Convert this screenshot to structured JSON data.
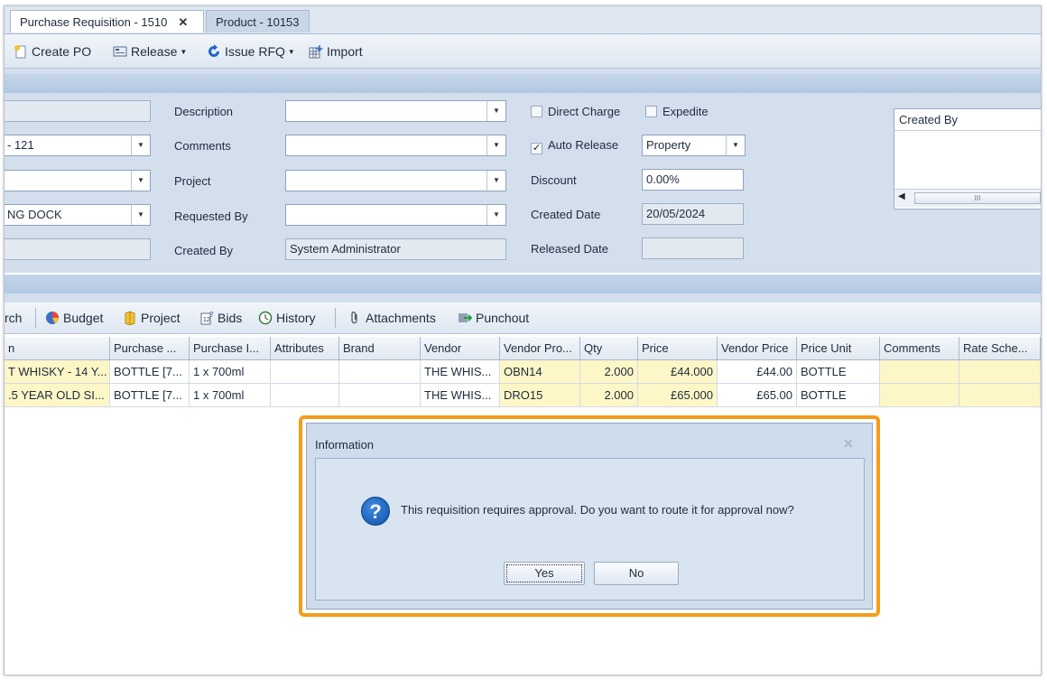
{
  "tabs": [
    {
      "label": "Purchase Requisition - 1510",
      "close": "✕"
    },
    {
      "label": "Product - 10153"
    }
  ],
  "toolbar": {
    "create_po": "Create PO",
    "release": "Release",
    "issue_rfq": "Issue RFQ",
    "import": "Import"
  },
  "form": {
    "left_col": {
      "field2_value": "- 121",
      "field3_value": "",
      "field4_value": "NG DOCK"
    },
    "mid_col": {
      "description_label": "Description",
      "comments_label": "Comments",
      "project_label": "Project",
      "requested_by_label": "Requested By",
      "created_by_label": "Created By",
      "created_by_value": "System Administrator"
    },
    "right_col": {
      "direct_charge_label": "Direct Charge",
      "expedite_label": "Expedite",
      "auto_release_label": "Auto Release",
      "auto_release_checked": "✓",
      "property_value": "Property",
      "discount_label": "Discount",
      "discount_value": "0.00%",
      "created_date_label": "Created Date",
      "created_date_value": "20/05/2024",
      "released_date_label": "Released Date"
    },
    "panel": {
      "header": "Created By",
      "scroll_thumb": "III"
    }
  },
  "grid_toolbar": {
    "search_fragment": "rch",
    "budget": "Budget",
    "project": "Project",
    "bids": "Bids",
    "history": "History",
    "attachments": "Attachments",
    "punchout": "Punchout"
  },
  "grid": {
    "columns": [
      "n",
      "Purchase ...",
      "Purchase I...",
      "Attributes",
      "Brand",
      "Vendor",
      "Vendor Pro...",
      "Qty",
      "Price",
      "Vendor Price",
      "Price Unit",
      "Comments",
      "Rate Sche..."
    ],
    "rows": [
      [
        "T WHISKY - 14 Y...",
        "BOTTLE [7...",
        "1 x 700ml",
        "",
        "",
        "THE WHIS...",
        "OBN14",
        "2.000",
        "£44.000",
        "£44.00",
        "BOTTLE",
        "",
        ""
      ],
      [
        ".5 YEAR OLD SI...",
        "BOTTLE [7...",
        "1 x 700ml",
        "",
        "",
        "THE WHIS...",
        "DRO15",
        "2.000",
        "£65.000",
        "£65.00",
        "BOTTLE",
        "",
        ""
      ]
    ]
  },
  "dialog": {
    "title": "Information",
    "close": "✕",
    "icon": "?",
    "message": "This requisition requires approval.  Do you want to route it for approval now?",
    "yes": "Yes",
    "no": "No"
  },
  "colors": {
    "highlight": "#f59c1a",
    "row_yellow": "#fdf6c6",
    "form_bg": "#d3dfed"
  }
}
